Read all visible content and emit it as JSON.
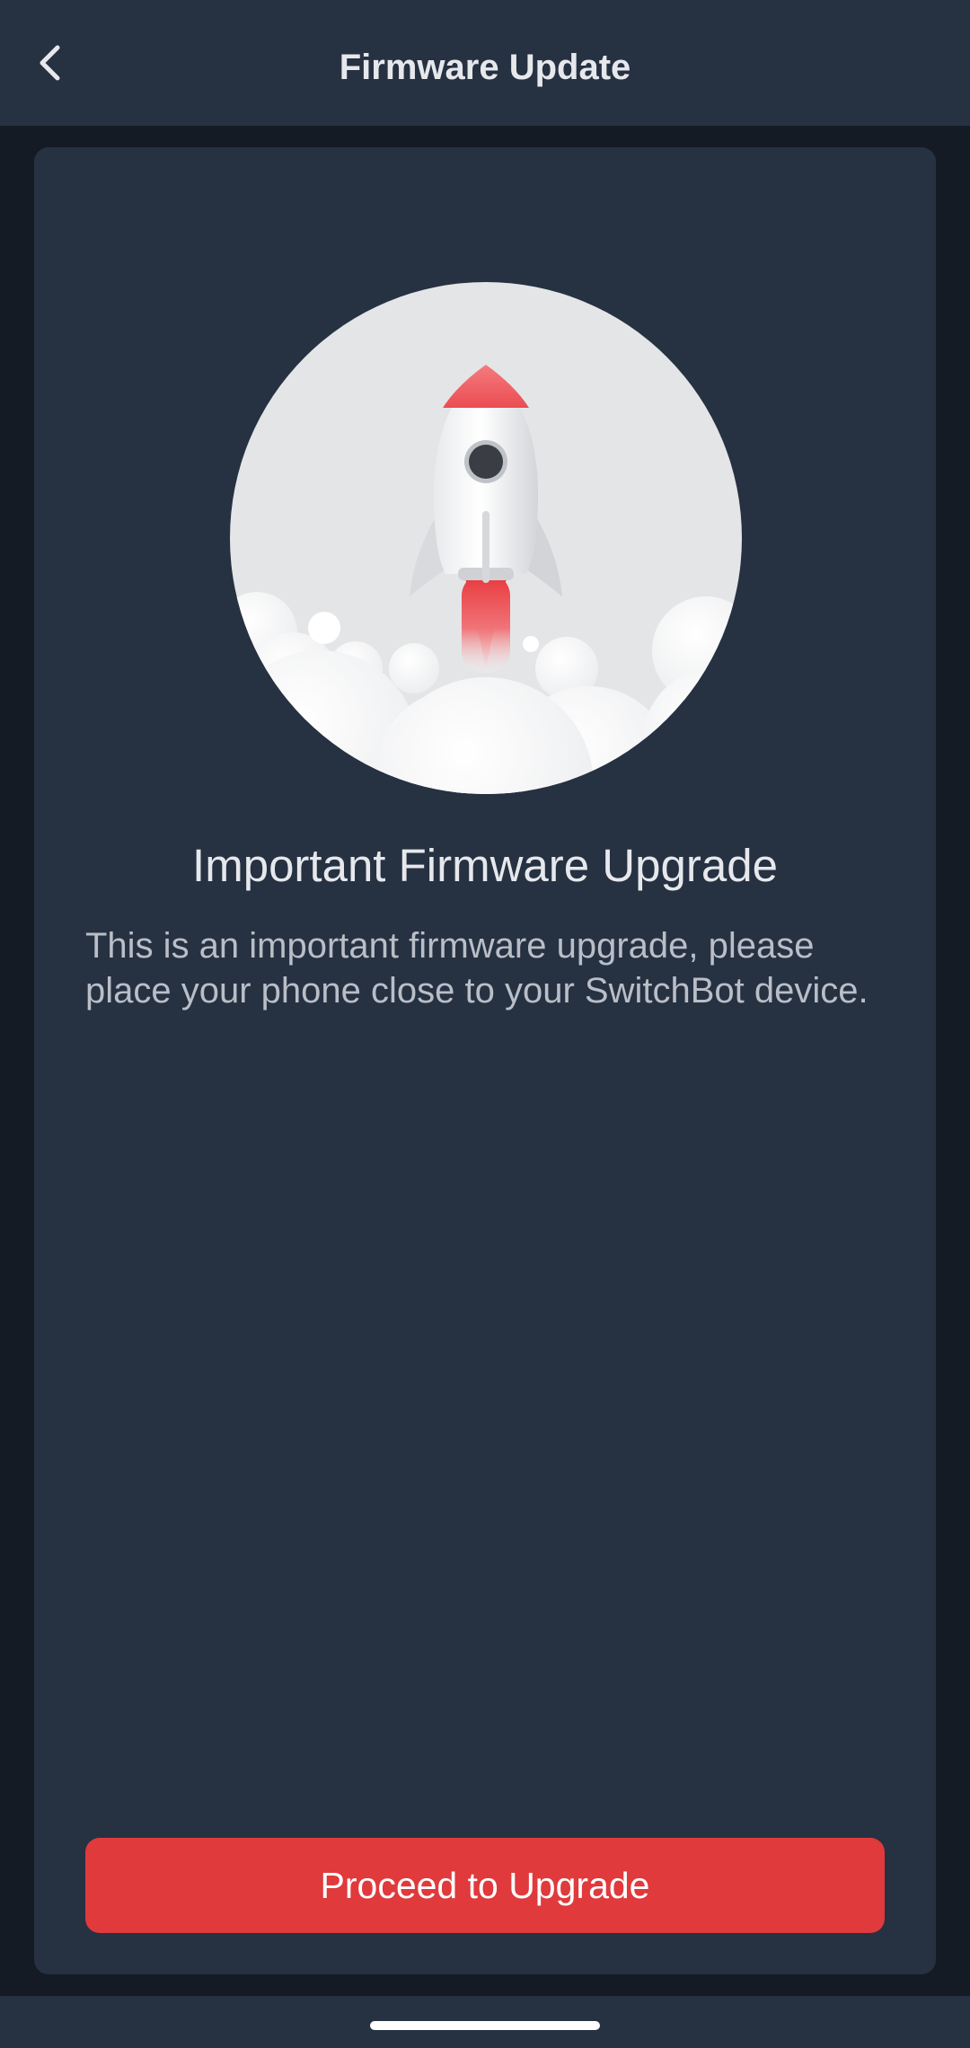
{
  "app_bar": {
    "title": "Firmware Update",
    "back_icon": "chevron-left-icon"
  },
  "card": {
    "illustration": "rocket-launch-illustration",
    "heading": "Important Firmware Upgrade",
    "description": "This is an important firmware upgrade, please place your phone close to your SwitchBot device.",
    "proceed_label": "Proceed to Upgrade"
  },
  "colors": {
    "background": "#141b25",
    "surface": "#263142",
    "accent": "#e03a3c",
    "text_primary": "#e6e8ec",
    "text_secondary": "#b9bec7"
  }
}
